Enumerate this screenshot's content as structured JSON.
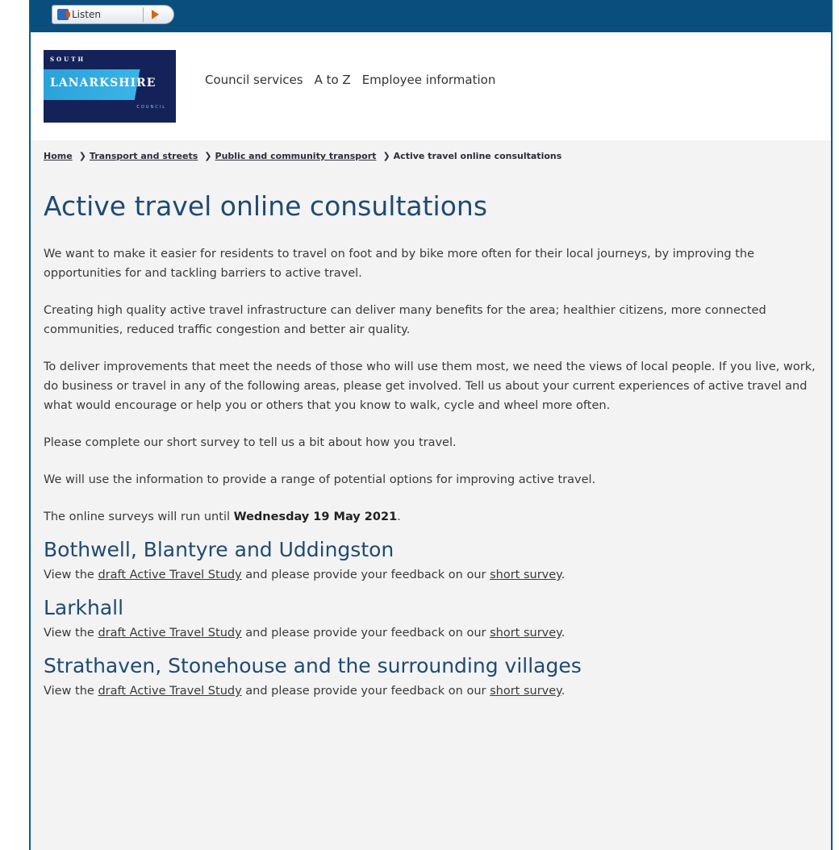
{
  "listen": {
    "label": "Listen"
  },
  "header": {
    "logo": {
      "line1": "SOUTH",
      "line2": "LANARKSHIRE",
      "line3": "COUNCIL"
    },
    "nav": [
      "Council services",
      "A to Z",
      "Employee information"
    ]
  },
  "breadcrumb": {
    "items": [
      "Home",
      "Transport and streets",
      "Public and community transport"
    ],
    "current": "Active travel online consultations"
  },
  "page": {
    "title": "Active travel online consultations",
    "paragraphs": [
      "We want to make it easier for residents to travel on foot and by bike more often for their local journeys, by improving the opportunities for and tackling barriers to active travel.",
      "Creating high quality active travel infrastructure can deliver many benefits for the area; healthier citizens, more connected communities, reduced traffic congestion and better air quality.",
      "To deliver improvements that meet the needs of those who will use them most, we need the views of local people. If you live, work, do business or travel in any of the following areas, please get involved. Tell us about your current experiences of active travel and what would encourage or help you or others that you know to walk, cycle and wheel more often.",
      "Please complete our short survey to tell us a bit about how you travel.",
      "We will use the information to provide a range of potential options for improving active travel."
    ],
    "deadline_prefix": "The online surveys will run until ",
    "deadline_date": "Wednesday 19 May 2021",
    "deadline_suffix": "."
  },
  "sections": [
    {
      "title": "Bothwell, Blantyre and Uddingston",
      "text_before": "View the ",
      "link1": "draft Active Travel Study",
      "text_middle": " and please provide your feedback on our ",
      "link2": "short survey",
      "text_after": "."
    },
    {
      "title": "Larkhall",
      "text_before": "View the ",
      "link1": "draft Active Travel Study",
      "text_middle": " and please provide your feedback on our ",
      "link2": "short survey",
      "text_after": "."
    },
    {
      "title": "Strathaven, Stonehouse and the surrounding villages",
      "text_before": "View the ",
      "link1": "draft Active Travel Study",
      "text_middle": " and please provide your feedback on our ",
      "link2": "short survey",
      "text_after": "."
    }
  ]
}
